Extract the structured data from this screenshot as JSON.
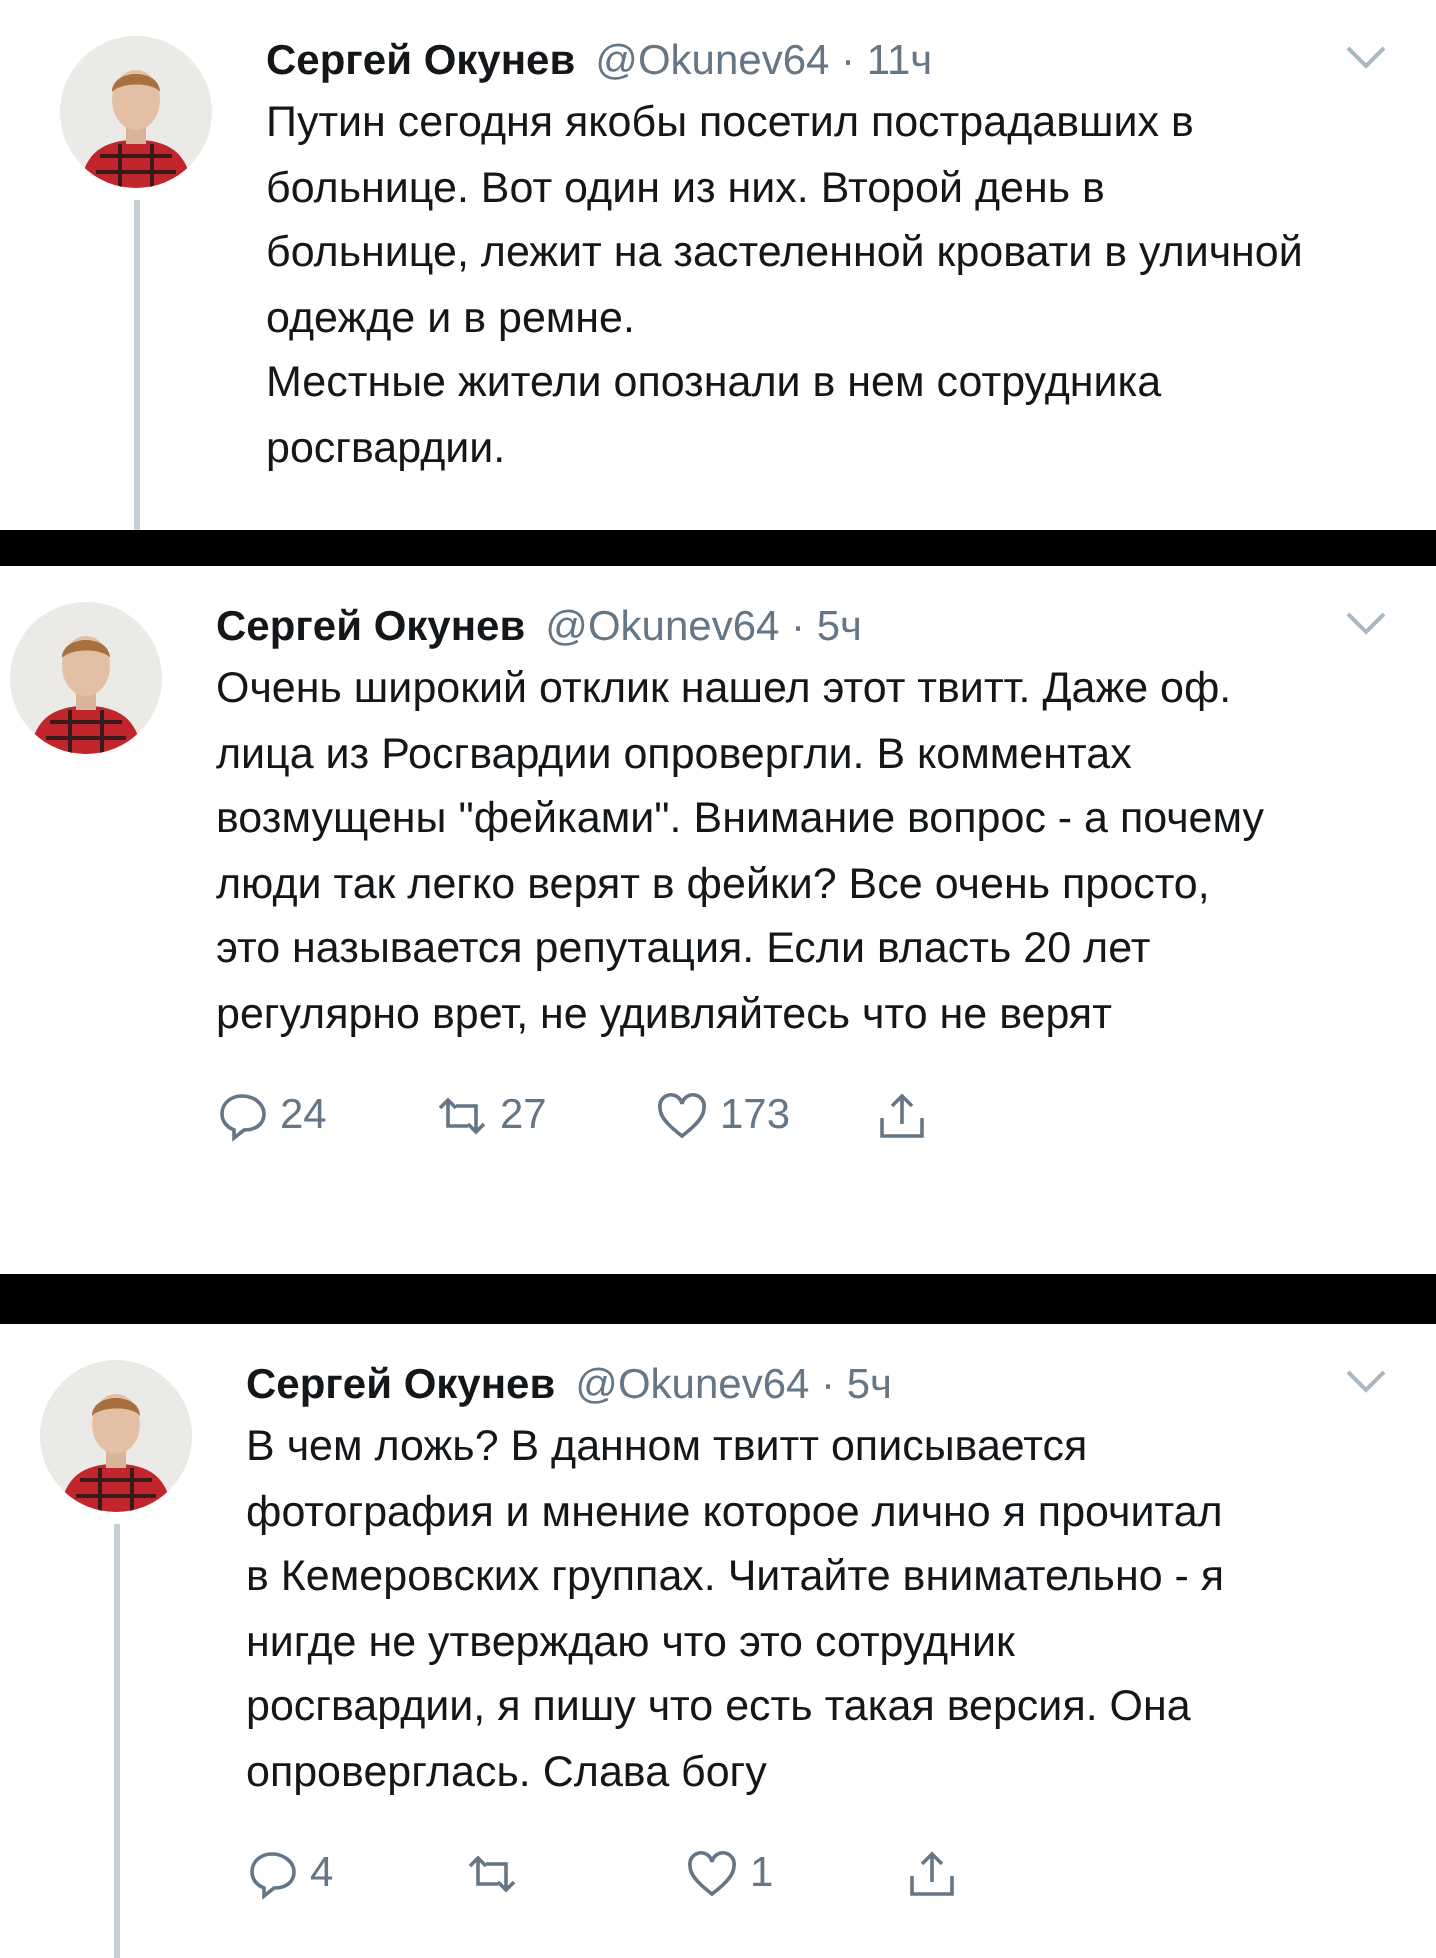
{
  "tweets": [
    {
      "author": "Сергей Окунев",
      "meta": "@Okunev64 · 11ч",
      "thread_line": true,
      "text": "Путин сегодня якобы посетил пострадавших в больнице. Вот один из них. Второй день в больнице, лежит на застеленной кровати в уличной одежде и в ремне.\nМестные жители опознали в нем сотрудника росгвардии."
    },
    {
      "author": "Сергей Окунев",
      "meta": "@Okunev64 · 5ч",
      "thread_line": false,
      "text": "Очень широкий отклик нашел этот твитт. Даже оф. лица из Росгвардии опровергли. В комментах возмущены \"фейками\". Внимание вопрос - а почему люди так легко верят в фейки? Все очень просто, это называется репутация. Если власть 20 лет регулярно врет, не удивляйтесь что не верят",
      "actions": {
        "replies": "24",
        "retweets": "27",
        "likes": "173"
      }
    },
    {
      "author": "Сергей Окунев",
      "meta": "@Okunev64 · 5ч",
      "thread_line": true,
      "text": "В чем ложь? В данном твитт описывается фотография и мнение которое лично я прочитал в Кемеровских группах. Читайте внимательно - я нигде не утверждаю что это сотрудник росгвардии, я пишу что есть такая версия. Она опроверглась. Слава богу",
      "actions": {
        "replies": "4",
        "likes": "1"
      }
    }
  ]
}
